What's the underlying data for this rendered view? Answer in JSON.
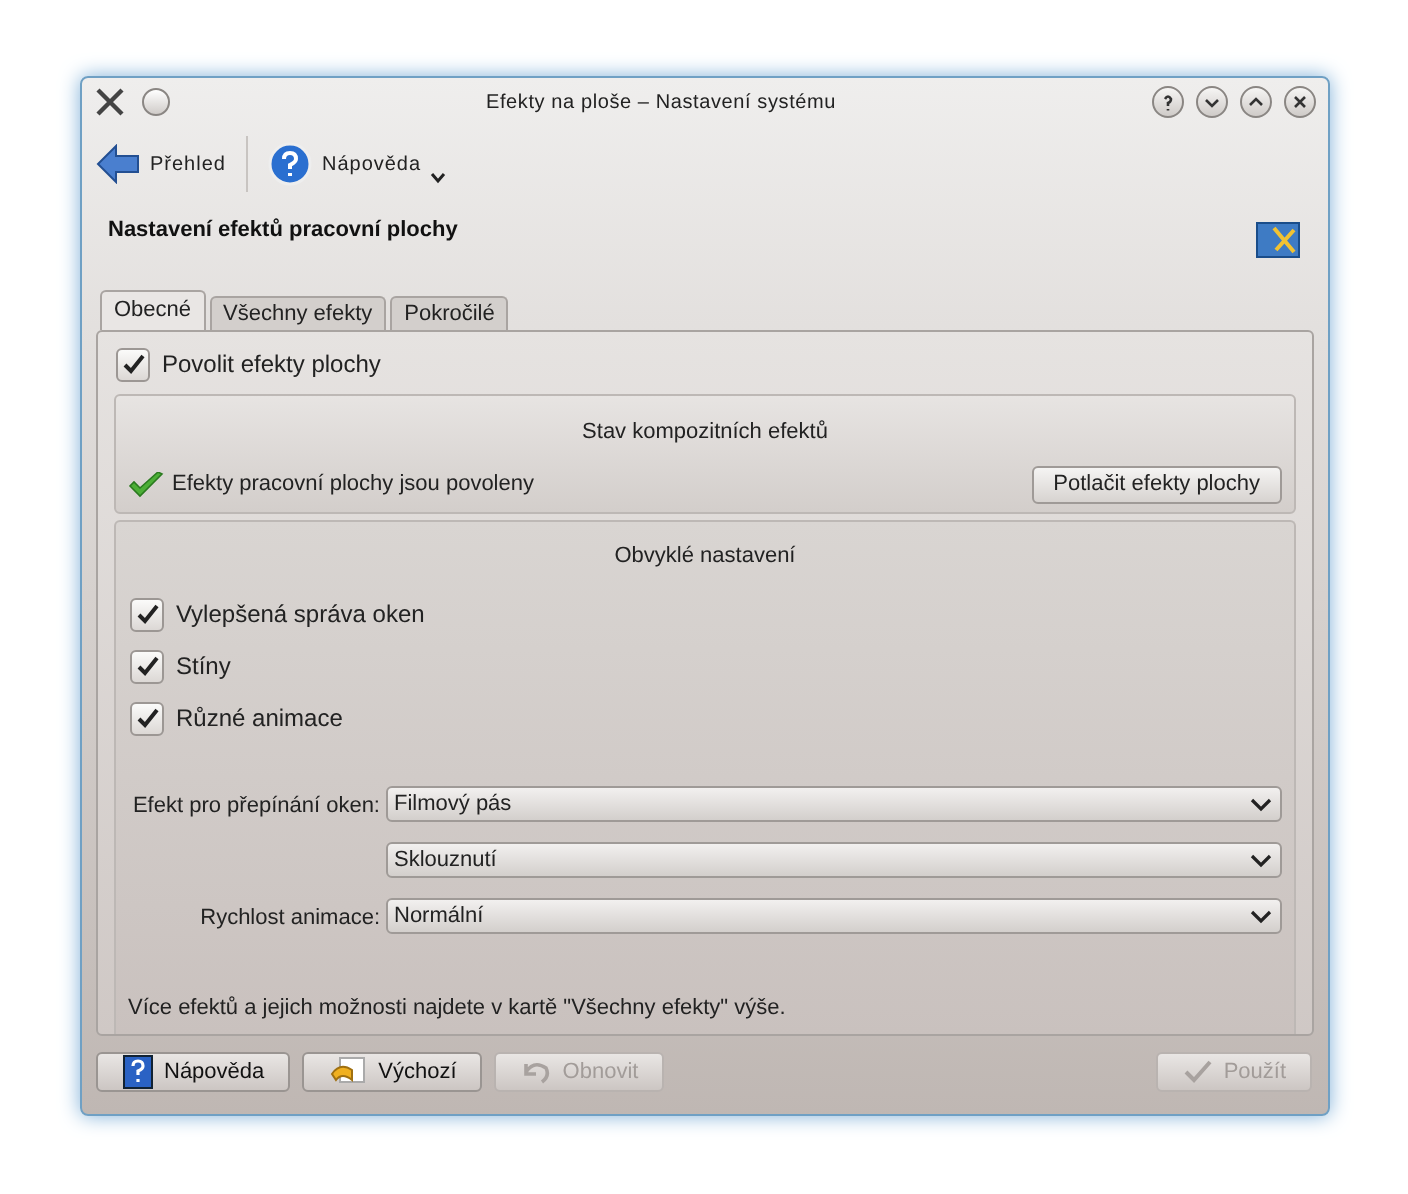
{
  "window": {
    "title": "Efekty na ploše – Nastavení systému"
  },
  "toolbar": [
    {
      "kind": "back",
      "label": "Přehled"
    },
    {
      "kind": "help",
      "label": "Nápověda"
    }
  ],
  "page_title": "Nastavení efektů pracovní plochy",
  "tabs": [
    {
      "label": "Obecné",
      "selected": true
    },
    {
      "label": "Všechny efekty",
      "selected": false
    },
    {
      "label": "Pokročilé",
      "selected": false
    }
  ],
  "enable": {
    "label": "Povolit efekty plochy",
    "checked": true
  },
  "status_group": {
    "title": "Stav kompozitních efektů",
    "status": "Efekty pracovní plochy jsou povoleny",
    "button": "Potlačit efekty plochy"
  },
  "general_group": {
    "title": "Obvyklé nastavení",
    "checkboxes": [
      {
        "label": "Vylepšená správa oken",
        "checked": true
      },
      {
        "label": "Stíny",
        "checked": true
      },
      {
        "label": "Různé animace",
        "checked": true
      }
    ],
    "selects": [
      {
        "label": "Efekt pro přepínání oken:",
        "value": "Filmový pás"
      },
      {
        "value": "Sklouznutí"
      },
      {
        "label": "Rychlost animace:",
        "value": "Normální"
      }
    ],
    "note": "Více efektů a jejich možnosti najdete v kartě \"Všechny efekty\" výše."
  },
  "buttons": [
    {
      "kind": "help",
      "label": "Nápověda",
      "disabled": false
    },
    {
      "kind": "defaults",
      "label": "Výchozí",
      "disabled": false
    },
    {
      "kind": "reset",
      "label": "Obnovit",
      "disabled": true
    },
    {
      "kind": "apply",
      "label": "Použít",
      "disabled": true
    }
  ]
}
